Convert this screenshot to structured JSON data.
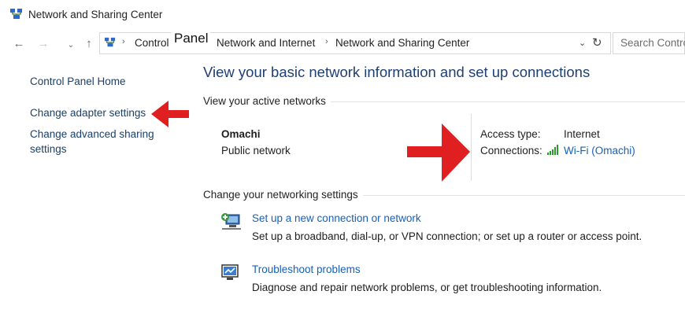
{
  "window": {
    "title": "Network and Sharing Center"
  },
  "address_bar": {
    "breadcrumbs": [
      "Control Panel",
      "Network and Internet",
      "Network and Sharing Center"
    ],
    "search_placeholder": "Search Control Panel"
  },
  "overlay": {
    "label": "Panel"
  },
  "sidebar": {
    "items": [
      {
        "label": "Control Panel Home"
      },
      {
        "label": "Change adapter settings"
      },
      {
        "label": "Change advanced sharing settings"
      }
    ]
  },
  "main": {
    "heading": "View your basic network information and set up connections",
    "active_networks": {
      "section_title": "View your active networks",
      "network_name": "Omachi",
      "network_type": "Public network",
      "access_type_label": "Access type:",
      "access_type_value": "Internet",
      "connections_label": "Connections:",
      "connections_value": "Wi-Fi (Omachi)"
    },
    "change_settings": {
      "section_title": "Change your networking settings",
      "items": [
        {
          "link": "Set up a new connection or network",
          "description": "Set up a broadband, dial-up, or VPN connection; or set up a router or access point.",
          "icon": "new-connection-icon"
        },
        {
          "link": "Troubleshoot problems",
          "description": "Diagnose and repair network problems, or get troubleshooting information.",
          "icon": "troubleshoot-icon"
        }
      ]
    }
  },
  "colors": {
    "heading": "#1e3f73",
    "link": "#1560b8",
    "arrow": "#e02020"
  }
}
